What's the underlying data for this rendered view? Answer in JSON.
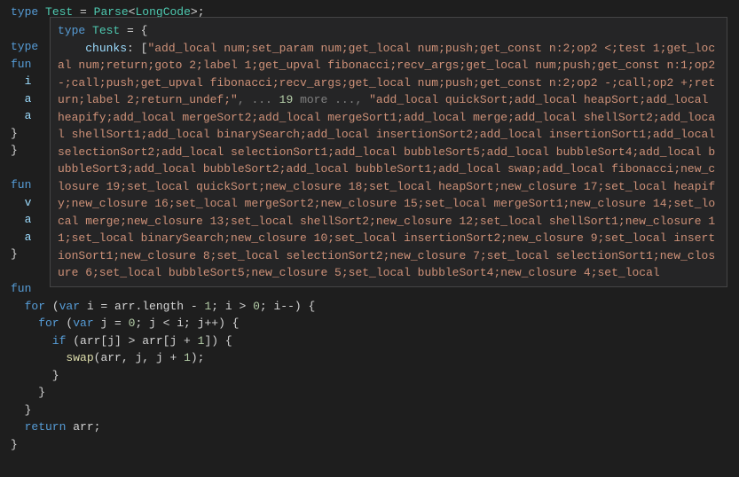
{
  "firstLine": {
    "type_kw": "type",
    "name": "Test",
    "eq": " = ",
    "parse": "Parse",
    "lt": "<",
    "long": "LongCode",
    "gt": ">;"
  },
  "bgLines": {
    "type_kw": "type",
    "fun1": "fun",
    "i": "  i",
    "a1": "  a",
    "a2": "  a",
    "brace1": "}",
    "brace2": "}",
    "fun2": "fun",
    "v": "  v",
    "a3": "  a",
    "a4": "  a",
    "brace3": "}",
    "fun3": "fun"
  },
  "hover": {
    "head": {
      "type_kw": "type",
      "name": " Test",
      "eq": " = {",
      "prop": "    chunks",
      "colon": ": ["
    },
    "str1": "\"add_local num;set_param num;get_local num;push;get_const n:2;op2 <;test 1;get_local num;return;goto 2;label 1;get_upval fibonacci;recv_args;get_local num;push;get_const n:1;op2 -;call;push;get_upval fibonacci;recv_args;get_local num;push;get_const n:2;op2 -;call;op2 +;return;label 2;return_undef;\"",
    "ellipsis": ", ... ",
    "more_num": "19",
    "more_txt": " more ",
    "ellipsis2": "...,",
    "str2": "\"add_local quickSort;add_local heapSort;add_local heapify;add_local mergeSort2;add_local mergeSort1;add_local merge;add_local shellSort2;add_local shellSort1;add_local binarySearch;add_local insertionSort2;add_local insertionSort1;add_local selectionSort2;add_local selectionSort1;add_local bubbleSort5;add_local bubbleSort4;add_local bubbleSort3;add_local bubbleSort2;add_local bubbleSort1;add_local swap;add_local fibonacci;new_closure 19;set_local quickSort;new_closure 18;set_local heapSort;new_closure 17;set_local heapify;new_closure 16;set_local mergeSort2;new_closure 15;set_local mergeSort1;new_closure 14;set_local merge;new_closure 13;set_local shellSort2;new_closure 12;set_local shellSort1;new_closure 11;set_local binarySearch;new_closure 10;set_local insertionSort2;new_closure 9;set_local insertionSort1;new_closure 8;set_local selectionSort2;new_closure 7;set_local selectionSort1;new_closure 6;set_local bubbleSort5;new_closure 5;set_local bubbleSort4;new_closure 4;set_local"
  },
  "code": {
    "l1_for": "  for",
    "l1_rest_a": " (",
    "l1_var": "var",
    "l1_rest_b": " i = arr.length - ",
    "l1_n1": "1",
    "l1_rest_c": "; i > ",
    "l1_n0": "0",
    "l1_rest_d": "; i--) {",
    "l2_for": "    for",
    "l2_rest_a": " (",
    "l2_var": "var",
    "l2_rest_b": " j = ",
    "l2_n0": "0",
    "l2_rest_c": "; j < i; j++) {",
    "l3_if": "      if",
    "l3_rest_a": " (arr[j] > arr[j + ",
    "l3_n1": "1",
    "l3_rest_b": "]) {",
    "l4_a": "        ",
    "l4_fn": "swap",
    "l4_b": "(arr, j, j + ",
    "l4_n1": "1",
    "l4_c": ");",
    "l5": "      }",
    "l6": "    }",
    "l7": "  }",
    "l8_ret": "  return",
    "l8_rest": " arr;",
    "l9": "}"
  }
}
